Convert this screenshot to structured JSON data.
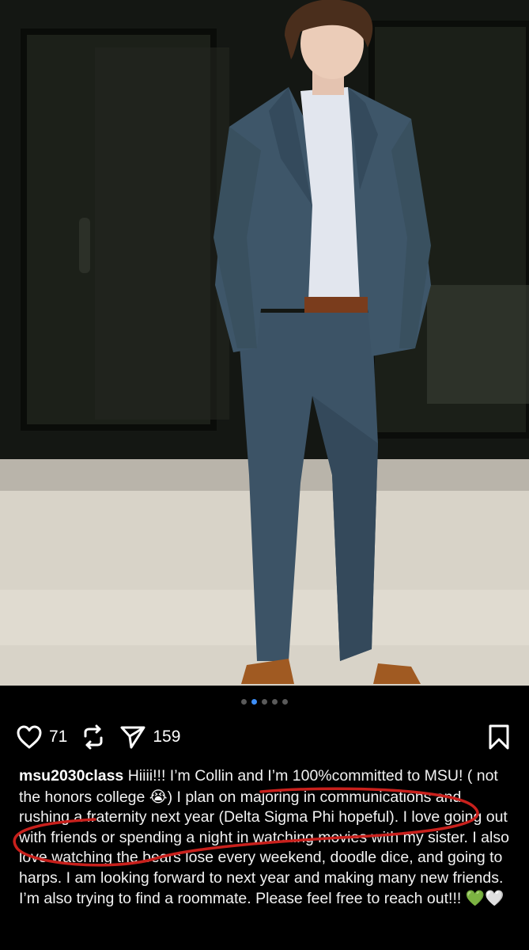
{
  "post": {
    "username": "msu2030class",
    "likes": "71",
    "shares": "159",
    "carousel": {
      "total": 5,
      "active": 1
    },
    "caption_before_emoji": "Hiiii!!! I’m Collin and I’m 100%committed to MSU! ( not the honors college",
    "caption_emoji": "😭",
    "caption_after_emoji": ") I plan on majoring in communications and rushing a fraternity next year (Delta Sigma Phi hopeful). I love going out with friends or spending a night in watching movies with my sister. I also love watching the bears lose every weekend, doodle dice, and going to harps. I am looking forward to next year and making many new friends. I’m also trying to find a roommate. Please feel free to reach out!!!",
    "caption_hearts": "💚🤍"
  },
  "icons": {
    "like": "heart-icon",
    "repost": "repost-icon",
    "share": "send-icon",
    "save": "bookmark-icon"
  },
  "colors": {
    "background": "#000000",
    "carousel_active": "#3d8ef7",
    "annotation": "#c8201c",
    "suit": "#3d5568"
  }
}
